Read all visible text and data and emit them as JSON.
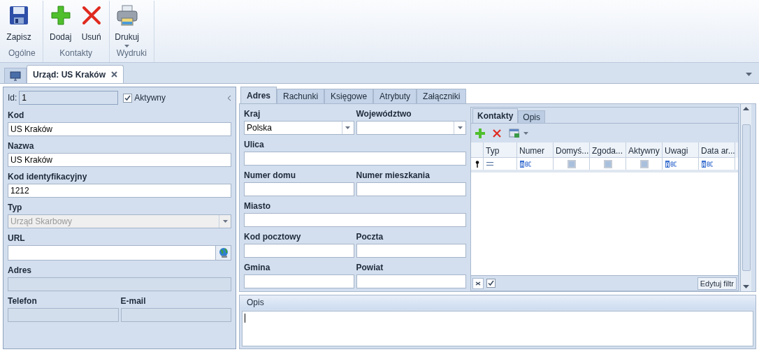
{
  "ribbon": {
    "groups": [
      {
        "label": "Ogólne",
        "buttons": [
          {
            "label": "Zapisz",
            "kind": "save",
            "menu": false
          }
        ]
      },
      {
        "label": "Kontakty",
        "buttons": [
          {
            "label": "Dodaj",
            "kind": "add",
            "menu": false
          },
          {
            "label": "Usuń",
            "kind": "delete",
            "menu": false
          }
        ]
      },
      {
        "label": "Wydruki",
        "buttons": [
          {
            "label": "Drukuj",
            "kind": "print",
            "menu": true
          }
        ]
      }
    ]
  },
  "document_tabs": [
    {
      "kind": "home",
      "selected": false
    },
    {
      "kind": "document",
      "label": "Urząd: US Kraków",
      "selected": true
    }
  ],
  "record_panel": {
    "id_label": "Id:",
    "id_value": "1",
    "active": {
      "label": "Aktywny",
      "checked": true
    },
    "rows": [
      [
        {
          "label": "Kod",
          "value": "US Kraków",
          "kind": "text",
          "disabled": false
        }
      ],
      [
        {
          "label": "Nazwa",
          "value": "US Kraków",
          "kind": "text",
          "disabled": false
        }
      ],
      [
        {
          "label": "Kod identyfikacyjny",
          "value": "1212",
          "kind": "text",
          "disabled": false
        }
      ],
      [
        {
          "label": "Typ",
          "value": "Urząd Skarbowy",
          "kind": "combo",
          "disabled": true
        }
      ],
      [
        {
          "label": "URL",
          "kind": "url",
          "disabled": false
        }
      ],
      [
        {
          "label": "Adres",
          "kind": "text",
          "disabled": true
        }
      ],
      [
        {
          "label": "Telefon",
          "kind": "text",
          "disabled": true
        },
        {
          "label": "E-mail",
          "kind": "text",
          "disabled": true
        }
      ]
    ]
  },
  "tabs": [
    {
      "label": "Adres",
      "selected": true
    },
    {
      "label": "Rachunki",
      "selected": false
    },
    {
      "label": "Księgowe",
      "selected": false
    },
    {
      "label": "Atrybuty",
      "selected": false
    },
    {
      "label": "Załączniki",
      "selected": false
    }
  ],
  "address_form": {
    "rows": [
      [
        {
          "label": "Kraj",
          "value": "Polska",
          "kind": "combo"
        },
        {
          "label": "Województwo",
          "kind": "combo"
        }
      ],
      [
        {
          "label": "Ulica",
          "kind": "text"
        }
      ],
      [
        {
          "label": "Numer domu",
          "kind": "text"
        },
        {
          "label": "Numer mieszkania",
          "kind": "text"
        }
      ],
      [
        {
          "label": "Miasto",
          "kind": "text"
        }
      ],
      [
        {
          "label": "Kod pocztowy",
          "kind": "text"
        },
        {
          "label": "Poczta",
          "kind": "text"
        }
      ],
      [
        {
          "label": "Gmina",
          "kind": "text"
        },
        {
          "label": "Powiat",
          "kind": "text"
        }
      ]
    ]
  },
  "contacts": {
    "tabs": [
      {
        "label": "Kontakty",
        "selected": true
      },
      {
        "label": "Opis",
        "selected": false
      }
    ],
    "columns": [
      "Typ",
      "Numer",
      "Domyś...",
      "Zgoda...",
      "Aktywny",
      "Uwagi",
      "Data ar..."
    ],
    "filter_row": [
      {
        "kind": "equals"
      },
      {
        "kind": "text"
      },
      {
        "kind": "checkbox",
        "checked": false
      },
      {
        "kind": "checkbox",
        "checked": false
      },
      {
        "kind": "checkbox",
        "checked": false
      },
      {
        "kind": "text"
      },
      {
        "kind": "text"
      }
    ],
    "filter_enabled": true,
    "edit_filter_button": "Edytuj filtr"
  },
  "description": {
    "header": "Opis"
  }
}
